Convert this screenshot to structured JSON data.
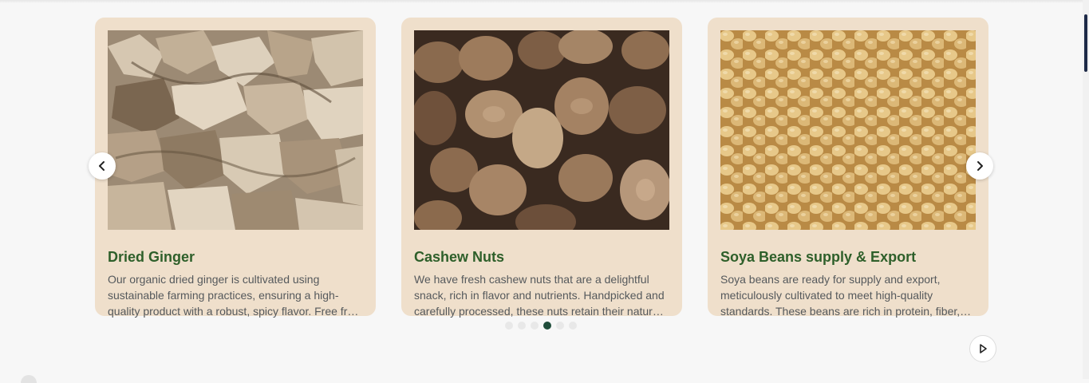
{
  "carousel": {
    "cards": [
      {
        "title": "Dried Ginger",
        "description": "Our organic dried ginger is cultivated using sustainable farming practices, ensuring a high-quality product with a robust, spicy flavor. Free from additives and preservatives, it is carefully dried to retain its natural goodness.",
        "image": "dried-ginger-photo"
      },
      {
        "title": "Cashew Nuts",
        "description": "We have fresh cashew nuts that are a delightful snack, rich in flavor and nutrients. Handpicked and carefully processed, these nuts retain their natural taste and crunch.",
        "image": "cashew-nuts-photo"
      },
      {
        "title": "Soya Beans supply & Export",
        "description": "Soya beans are ready for supply and export, meticulously cultivated to meet high-quality standards. These beans are rich in protein, fiber, and essential nutrients.",
        "image": "soya-beans-photo"
      }
    ],
    "pagination": {
      "total": 6,
      "active_index": 3
    },
    "controls": {
      "prev_icon": "chevron-left-icon",
      "next_icon": "chevron-right-icon",
      "autoplay_icon": "play-icon"
    }
  },
  "colors": {
    "card_background": "#efdfcb",
    "title": "#2e5f2a",
    "description": "#55595c",
    "active_dot": "#1f4d3a"
  }
}
